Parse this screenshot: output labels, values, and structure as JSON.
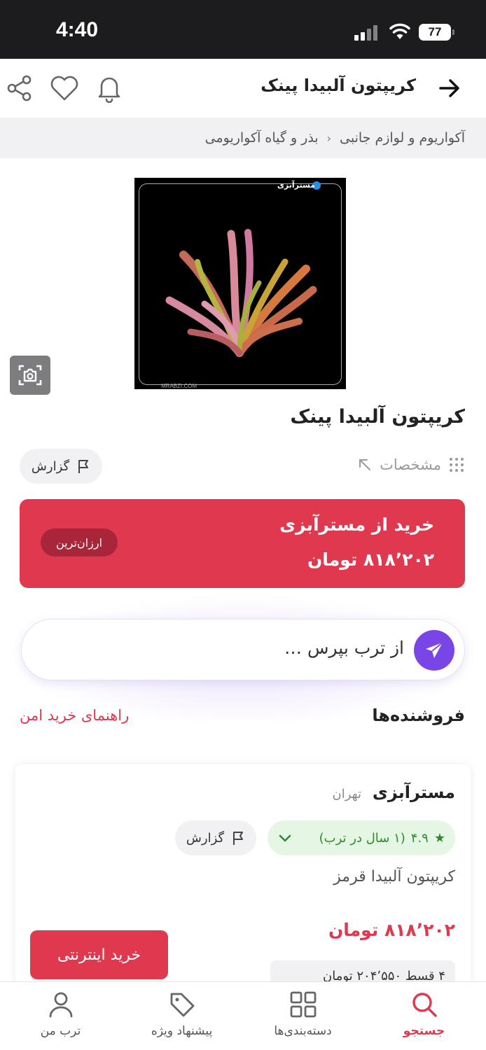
{
  "status_bar": {
    "time": "4:40",
    "battery": "77"
  },
  "header": {
    "title": "کریپتون آلبیدا پینک"
  },
  "breadcrumb": {
    "items": [
      "آکواریوم و لوازم جانبی",
      "بذر و گیاه آکواریومی"
    ]
  },
  "product_image": {
    "watermark_top": "مسترآبزی",
    "watermark_bottom": "MRABZI.COM"
  },
  "product": {
    "title": "کریپتون آلبیدا پینک",
    "specs_label": "مشخصات",
    "report_label": "گزارش"
  },
  "buy_banner": {
    "title": "خرید از مسترآبزی",
    "price": "۸۱۸٬۲۰۲ تومان",
    "badge": "ارزان‌ترین"
  },
  "ask": {
    "placeholder": "از ترب بپرس …"
  },
  "sellers": {
    "title": "فروشنده‌ها",
    "safe_guide": "راهنمای خرید امن",
    "items": [
      {
        "name": "مسترآبزی",
        "city": "تهران",
        "rating": "۴.۹",
        "tenure": "(۱ سال در ترب)",
        "report_label": "گزارش",
        "product_name": "کریپتون آلبیدا قرمز",
        "price": "۸۱۸٬۲۰۲ تومان",
        "buy_label": "خرید اینترنتی",
        "installment": "۴ قسط ۲۰۴٬۵۵۰ تومان"
      }
    ]
  },
  "bottom_nav": {
    "items": [
      {
        "label": "جستجو",
        "icon": "search-icon",
        "active": true
      },
      {
        "label": "دسته‌بندی‌ها",
        "icon": "grid-icon",
        "active": false
      },
      {
        "label": "پیشنهاد ویژه",
        "icon": "tag-icon",
        "active": false
      },
      {
        "label": "ترب من",
        "icon": "user-icon",
        "active": false
      }
    ]
  },
  "colors": {
    "accent": "#e0384e",
    "ask_button": "#7a45e6",
    "rating_bg": "#e6f6e4",
    "rating_text": "#2f8a2f"
  }
}
